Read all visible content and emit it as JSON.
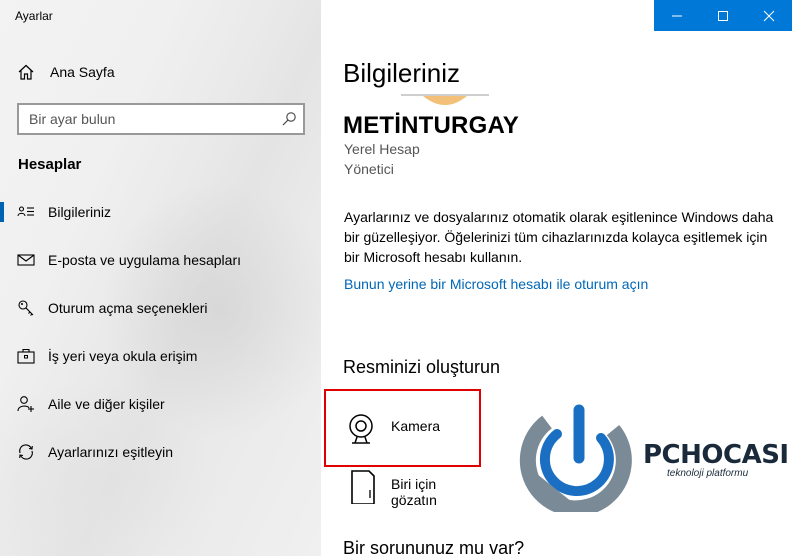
{
  "window": {
    "title": "Ayarlar"
  },
  "sidebar": {
    "home_label": "Ana Sayfa",
    "search_placeholder": "Bir ayar bulun",
    "section_title": "Hesaplar",
    "items": [
      {
        "label": "Bilgileriniz",
        "icon": "person-card-icon",
        "selected": true
      },
      {
        "label": "E-posta ve uygulama hesapları",
        "icon": "mail-icon",
        "selected": false
      },
      {
        "label": "Oturum açma seçenekleri",
        "icon": "key-icon",
        "selected": false
      },
      {
        "label": "İş yeri veya okula erişim",
        "icon": "briefcase-icon",
        "selected": false
      },
      {
        "label": "Aile ve diğer kişiler",
        "icon": "add-person-icon",
        "selected": false
      },
      {
        "label": "Ayarlarınızı eşitleyin",
        "icon": "sync-icon",
        "selected": false
      }
    ]
  },
  "main": {
    "title": "Bilgileriniz",
    "username": "METİNTURGAY",
    "account_type": "Yerel Hesap",
    "account_role": "Yönetici",
    "info_text": "Ayarlarınız ve dosyalarınız otomatik olarak eşitlenince Windows daha bir güzelleşiyor. Öğelerinizi tüm cihazlarınızda kolayca eşitlemek için bir Microsoft hesabı kullanın.",
    "ms_link": "Bunun yerine bir Microsoft hesabı ile oturum açın",
    "create_title": "Resminizi oluşturun",
    "options": [
      {
        "label": "Kamera",
        "icon": "camera-icon"
      },
      {
        "label": "Biri için gözatın",
        "icon": "browse-file-icon"
      }
    ],
    "help_title": "Bir sorununuz mu var?"
  },
  "watermark": {
    "brand": "PCHOCASI",
    "tagline": "teknoloji platformu"
  },
  "colors": {
    "accent": "#0078d7",
    "link": "#0067b8",
    "highlight": "#e00000"
  }
}
